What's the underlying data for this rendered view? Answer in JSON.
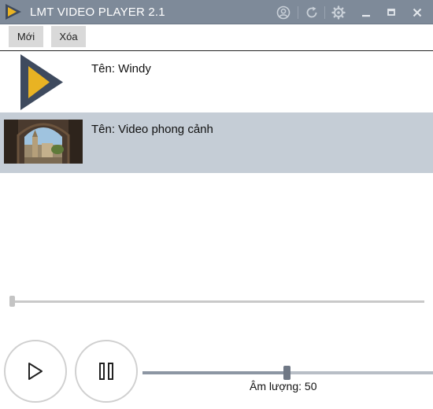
{
  "window": {
    "title": "LMT VIDEO PLAYER 2.1",
    "icons": [
      "play-logo-icon",
      "user-circle-icon",
      "refresh-icon",
      "gear-icon",
      "minimize-icon",
      "maximize-icon",
      "close-icon"
    ]
  },
  "toolbar": {
    "new_label": "Mới",
    "delete_label": "Xóa"
  },
  "playlist": {
    "items": [
      {
        "name": "Tên: Windy",
        "thumbnail": "play-logo",
        "selected": false
      },
      {
        "name": "Tên: Video phong cảnh",
        "thumbnail": "landscape-photo",
        "selected": true
      }
    ]
  },
  "player": {
    "seek_position": 0,
    "volume_label": "Âm lượng: 50",
    "volume": 50
  },
  "colors": {
    "titlebar": "#7e8a99",
    "selected_row": "#c5cdd6",
    "logo_yellow": "#e9b323",
    "logo_dark": "#3e4a5e"
  }
}
